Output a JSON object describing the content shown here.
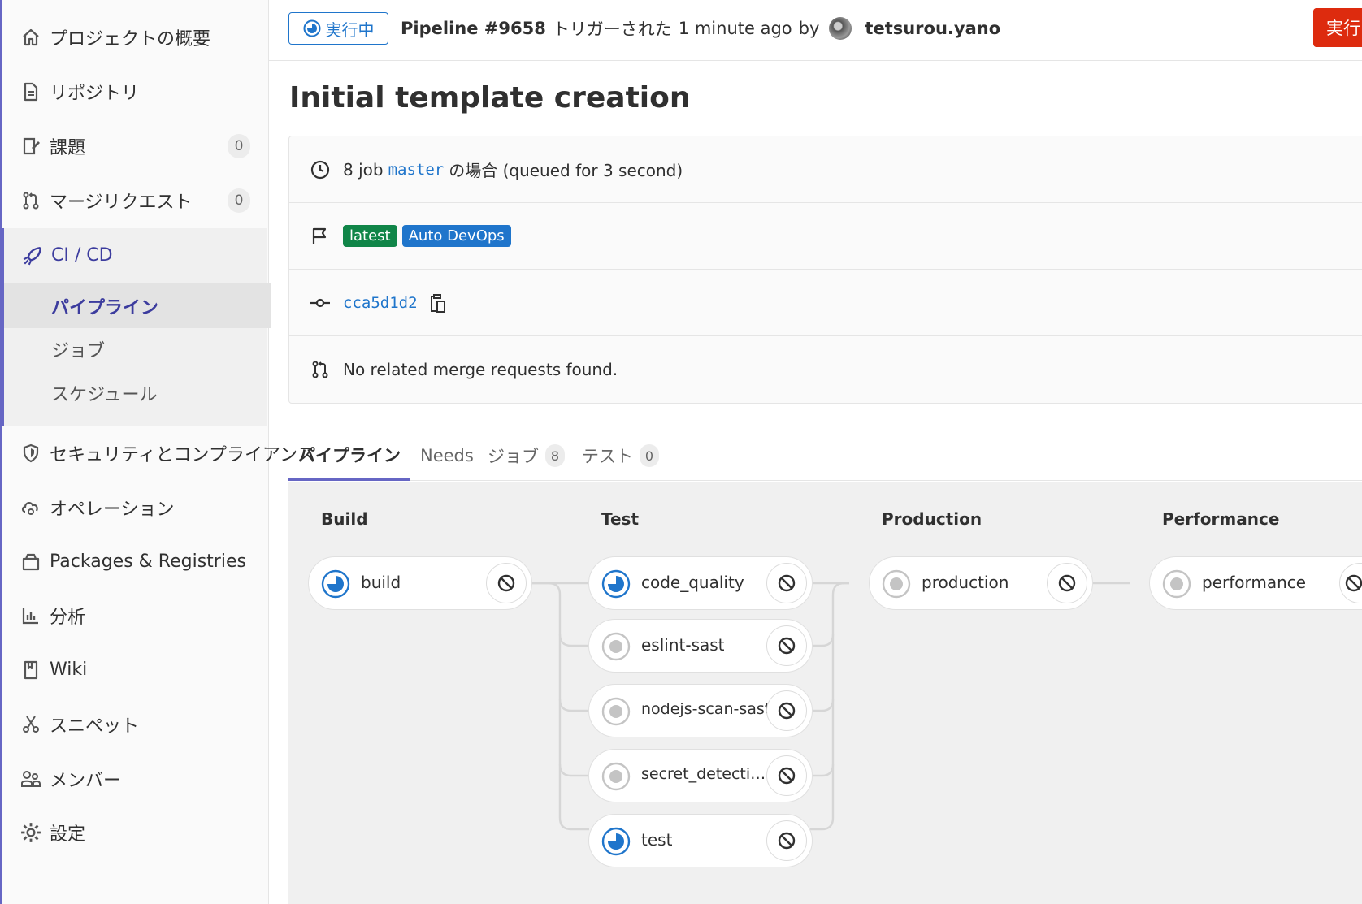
{
  "sidebar": {
    "items": [
      {
        "label": "プロジェクトの概要",
        "icon": "home-icon"
      },
      {
        "label": "リポジトリ",
        "icon": "document-icon"
      },
      {
        "label": "課題",
        "icon": "issues-icon",
        "count": "0"
      },
      {
        "label": "マージリクエスト",
        "icon": "merge-request-icon",
        "count": "0"
      },
      {
        "label": "CI / CD",
        "icon": "rocket-icon"
      },
      {
        "label": "セキュリティとコンプライアンス",
        "icon": "shield-icon"
      },
      {
        "label": "オペレーション",
        "icon": "cloud-gear-icon"
      },
      {
        "label": "Packages & Registries",
        "icon": "package-icon"
      },
      {
        "label": "分析",
        "icon": "chart-icon"
      },
      {
        "label": "Wiki",
        "icon": "book-icon"
      },
      {
        "label": "スニペット",
        "icon": "scissors-icon"
      },
      {
        "label": "メンバー",
        "icon": "users-icon"
      },
      {
        "label": "設定",
        "icon": "gear-icon"
      }
    ],
    "cicd_sub": [
      "パイプライン",
      "ジョブ",
      "スケジュール"
    ]
  },
  "header": {
    "status": "実行中",
    "pipeline": "Pipeline #9658",
    "triggered": "トリガーされた",
    "time": "1 minute ago",
    "by": "by",
    "user": "tetsurou.yano",
    "retry_label": "実行中"
  },
  "title": "Initial template creation",
  "info": {
    "jobs_prefix": "8 job",
    "branch": "master",
    "jobs_suffix": "の場合 (queued for 3 second)",
    "badge_latest": "latest",
    "badge_autodevops": "Auto DevOps",
    "commit": "cca5d1d2",
    "merge_requests": "No related merge requests found."
  },
  "tabs": [
    {
      "label": "パイプライン"
    },
    {
      "label": "Needs"
    },
    {
      "label": "ジョブ",
      "count": "8"
    },
    {
      "label": "テスト",
      "count": "0"
    }
  ],
  "stages": [
    {
      "name": "Build",
      "jobs": [
        {
          "name": "build",
          "status": "running"
        }
      ]
    },
    {
      "name": "Test",
      "jobs": [
        {
          "name": "code_quality",
          "status": "running"
        },
        {
          "name": "eslint-sast",
          "status": "pending"
        },
        {
          "name": "nodejs-scan-sast",
          "status": "pending"
        },
        {
          "name": "secret_detection",
          "display": "secret_detectio...",
          "status": "pending"
        },
        {
          "name": "test",
          "status": "running"
        }
      ]
    },
    {
      "name": "Production",
      "jobs": [
        {
          "name": "production",
          "status": "pending"
        }
      ]
    },
    {
      "name": "Performance",
      "jobs": [
        {
          "name": "performance",
          "status": "pending"
        }
      ]
    }
  ],
  "colors": {
    "accent": "#6666c4",
    "running": "#1f75cb",
    "danger": "#dd2b0e",
    "success_badge": "#108548"
  }
}
